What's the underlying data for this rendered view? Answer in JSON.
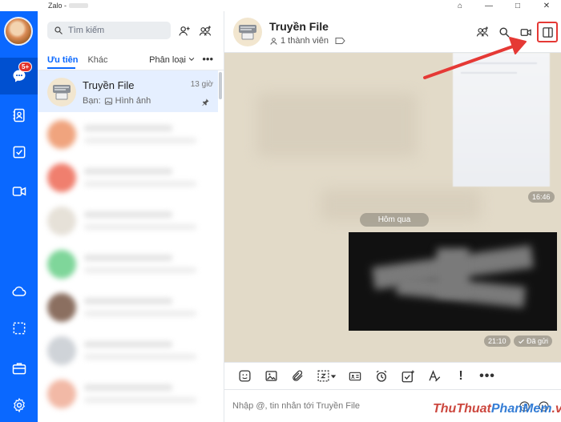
{
  "window": {
    "title": "Zalo -",
    "controls": [
      "⌂",
      "—",
      "□",
      "✕"
    ]
  },
  "nav": {
    "messages_badge": "5+",
    "items": [
      "messages-icon",
      "contacts-icon",
      "todo-icon",
      "video-icon",
      "cloud-icon",
      "screenshot-icon",
      "briefcase-icon",
      "settings-icon"
    ]
  },
  "list": {
    "search_placeholder": "Tìm kiếm",
    "tabs": [
      "Ưu tiên",
      "Khác"
    ],
    "filter_label": "Phân loại",
    "more": "•••",
    "conversation": {
      "name": "Truyền File",
      "time": "13 giờ",
      "preview_prefix": "Bạn:",
      "preview_text": "Hình ảnh"
    }
  },
  "chat": {
    "title": "Truyền File",
    "members": "1 thành viên",
    "time_first": "16:46",
    "date_separator": "Hôm qua",
    "time_second": "21:10",
    "sent_status": "Đã gửi",
    "toolbar": {
      "exclaim": "!",
      "more": "•••"
    },
    "input_placeholder": "Nhập @, tin nhắn tới Truyền File"
  },
  "watermark": {
    "part1": "ThuThuat",
    "part2": "PhanMem",
    "part3": ".vn"
  },
  "colors": {
    "primary": "#0a68ff",
    "nav_active": "#0050d0",
    "badge": "#e0332c",
    "chat_bg": "#e2dac8",
    "selected_row": "#e5efff",
    "highlight": "#e53935"
  }
}
